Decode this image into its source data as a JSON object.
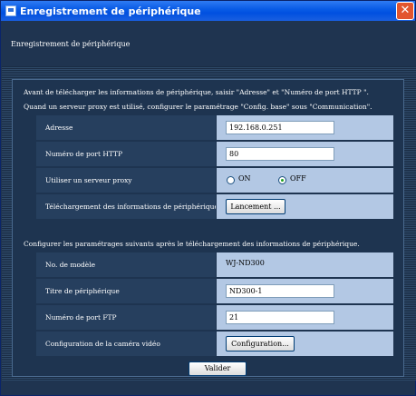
{
  "window": {
    "title": "Enregistrement de périphérique",
    "close_label": "✕"
  },
  "header": {
    "title": "Enregistrement de périphérique"
  },
  "section1": {
    "info_line1": "Avant de télécharger les informations de périphérique, saisir \"Adresse\" et \"Numéro de port HTTP \".",
    "info_line2": "Quand un serveur proxy est utilisé, configurer le paramétrage \"Config. base\" sous \"Communication\".",
    "address_label": "Adresse",
    "address_value": "192.168.0.251",
    "http_port_label": "Numéro de port HTTP",
    "http_port_value": "80",
    "proxy_label": "Utiliser un serveur proxy",
    "proxy_on_label": "ON",
    "proxy_off_label": "OFF",
    "proxy_selected": "OFF",
    "download_label": "Téléchargement des informations de périphérique",
    "download_button": "Lancement ..."
  },
  "section2": {
    "info_line": "Configurer les paramétrages suivants après le téléchargement des informations de périphérique.",
    "model_label": "No. de modèle",
    "model_value": "WJ-ND300",
    "device_title_label": "Titre de périphérique",
    "device_title_value": "ND300-1",
    "ftp_port_label": "Numéro de port FTP",
    "ftp_port_value": "21",
    "camera_config_label": "Configuration de la caméra vidéo",
    "camera_config_button": "Configuration..."
  },
  "footer": {
    "submit_button": "Valider"
  }
}
